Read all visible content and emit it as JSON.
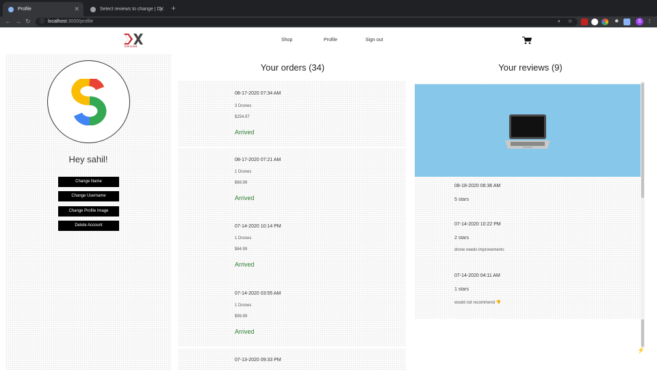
{
  "browser": {
    "tabs": [
      {
        "title": "Profile",
        "active": true
      },
      {
        "title": "Select reviews to change | Dj…",
        "active": false
      }
    ],
    "url_host": "localhost",
    "url_path": ":3000/profile",
    "profile_initial": "S"
  },
  "header": {
    "logo_text": "DRONE",
    "nav": [
      "Shop",
      "Profile",
      "Sign out"
    ]
  },
  "profile": {
    "greeting": "Hey sahil!",
    "buttons": [
      "Change Name",
      "Change Username",
      "Change Profile Image",
      "Delete Account"
    ]
  },
  "orders": {
    "title": "Your orders (34)",
    "items": [
      {
        "date": "08-17-2020 07:34 AM",
        "qty": "3 Drones",
        "price": "$254.97",
        "status": "Arrived"
      },
      {
        "date": "08-17-2020 07:21 AM",
        "qty": "1 Drones",
        "price": "$69.99",
        "status": "Arrived"
      },
      {
        "date": "07-14-2020 10:14 PM",
        "qty": "1 Drones",
        "price": "$84.99",
        "status": "Arrived"
      },
      {
        "date": "07-14-2020 03:55 AM",
        "qty": "1 Drones",
        "price": "$99.99",
        "status": "Arrived"
      },
      {
        "date": "07-13-2020 09:33 PM",
        "qty": "",
        "price": "",
        "status": ""
      }
    ]
  },
  "reviews": {
    "title": "Your reviews (9)",
    "items": [
      {
        "date": "08-18-2020 06:36 AM",
        "stars": "5 stars",
        "comment": ""
      },
      {
        "date": "07-14-2020 10:22 PM",
        "stars": "2 stars",
        "comment": "drone needs improvements"
      },
      {
        "date": "07-14-2020 04:11 AM",
        "stars": "1 stars",
        "comment": "would not recommend 👎"
      }
    ]
  },
  "colors": {
    "status_green": "#2e7d32",
    "review_image_bg": "#87c8ea",
    "button_bg": "#000000"
  }
}
